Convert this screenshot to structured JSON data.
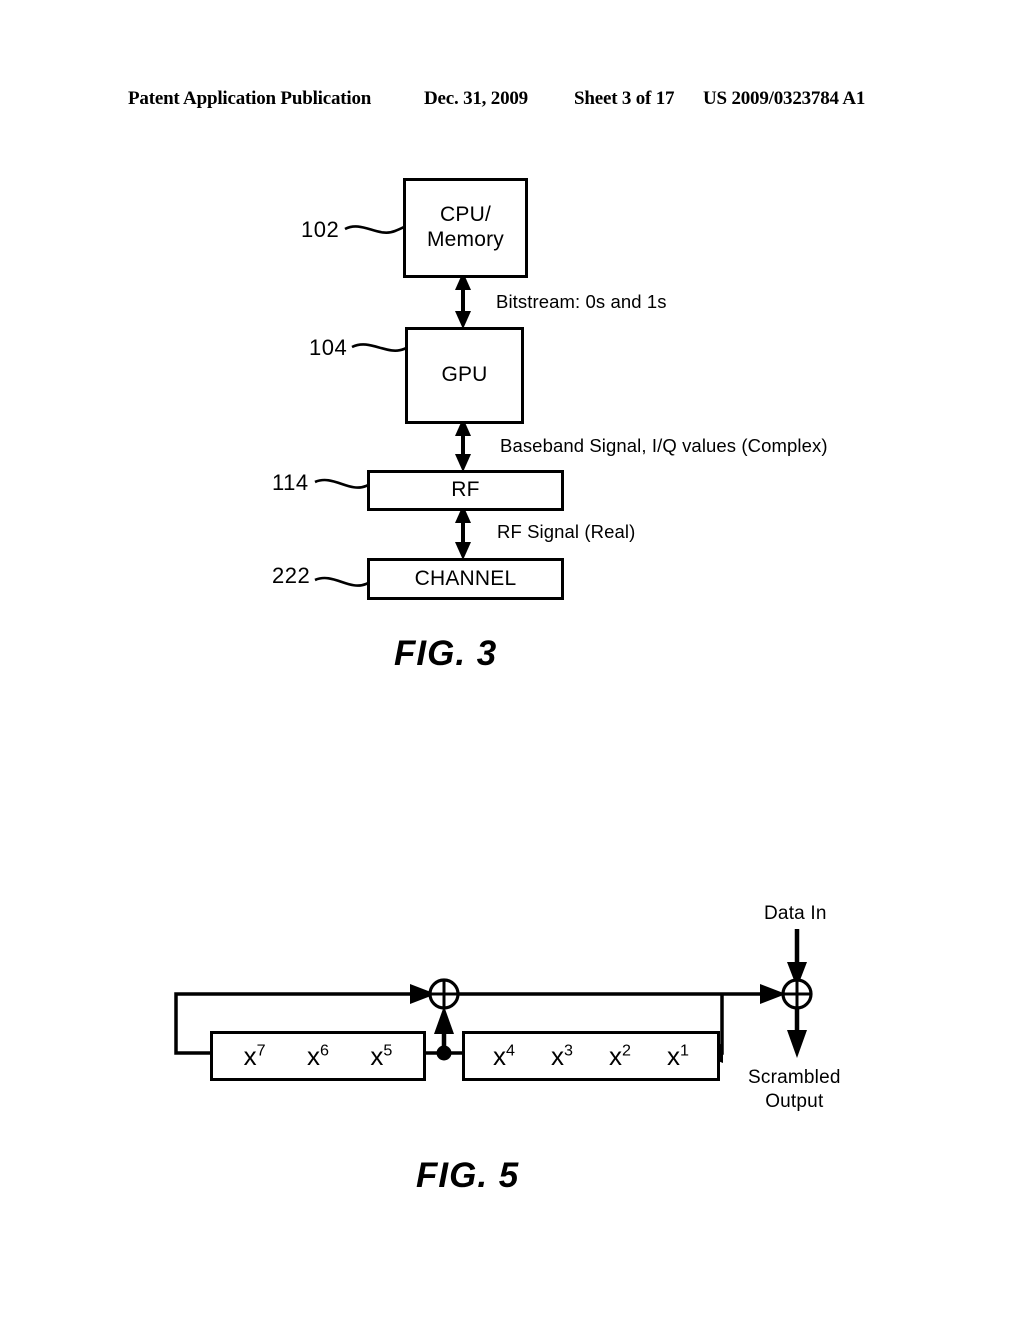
{
  "header": {
    "publication": "Patent Application Publication",
    "date": "Dec. 31, 2009",
    "sheet": "Sheet 3 of 17",
    "patent_number": "US 2009/0323784 A1"
  },
  "figure3": {
    "caption": "FIG. 3",
    "blocks": [
      {
        "ref": "102",
        "label": "CPU/\nMemory",
        "label_line1": "CPU/",
        "label_line2": "Memory"
      },
      {
        "ref": "104",
        "label": "GPU"
      },
      {
        "ref": "114",
        "label": "RF"
      },
      {
        "ref": "222",
        "label": "CHANNEL"
      }
    ],
    "signals": [
      {
        "id": "bitstream",
        "label": "Bitstream: 0s and 1s"
      },
      {
        "id": "baseband",
        "label": "Baseband Signal, I/Q values (Complex)"
      },
      {
        "id": "rf_signal",
        "label": "RF Signal (Real)"
      }
    ],
    "reference_numerals": {
      "cpu_memory": "102",
      "gpu": "104",
      "rf": "114",
      "channel": "222"
    }
  },
  "figure5": {
    "caption": "FIG. 5",
    "data_in_label": "Data In",
    "output_label_line1": "Scrambled",
    "output_label_line2": "Output",
    "register_left": {
      "cells": [
        {
          "base": "x",
          "exp": "7"
        },
        {
          "base": "x",
          "exp": "6"
        },
        {
          "base": "x",
          "exp": "5"
        }
      ]
    },
    "register_right": {
      "cells": [
        {
          "base": "x",
          "exp": "4"
        },
        {
          "base": "x",
          "exp": "3"
        },
        {
          "base": "x",
          "exp": "2"
        },
        {
          "base": "x",
          "exp": "1"
        }
      ]
    },
    "xor_operators": [
      {
        "id": "feedback-xor",
        "symbol": "+"
      },
      {
        "id": "output-xor",
        "symbol": "+"
      }
    ]
  },
  "colors": {
    "ink": "#000000",
    "paper": "#ffffff"
  }
}
